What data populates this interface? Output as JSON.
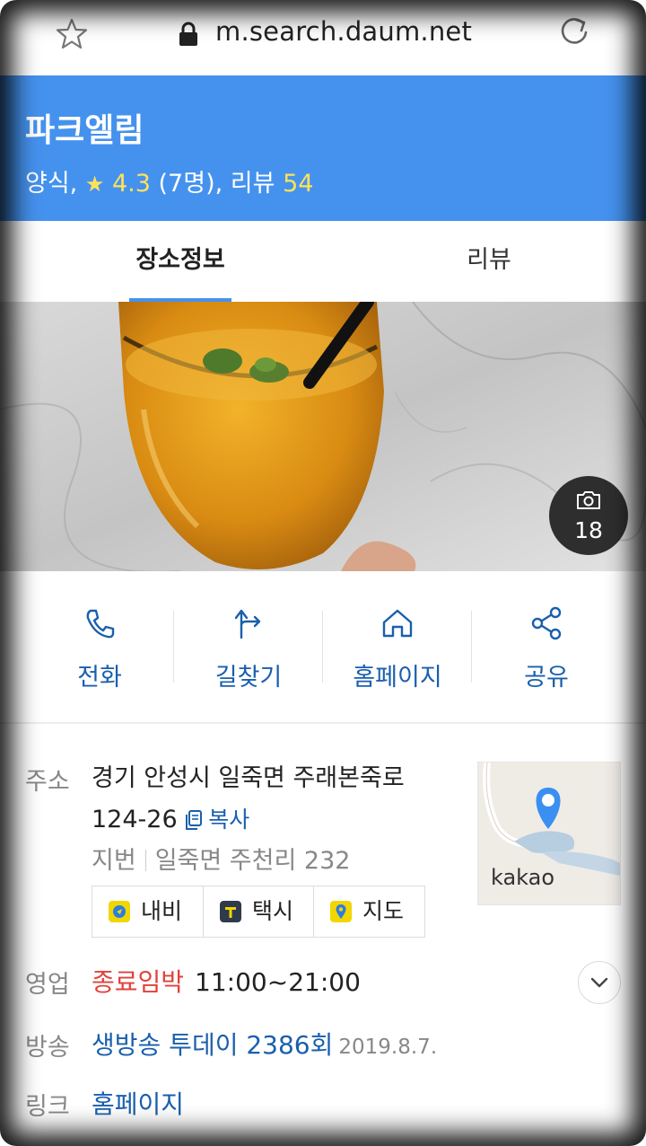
{
  "browser": {
    "url": "m.search.daum.net"
  },
  "header": {
    "name": "파크엘림",
    "category": "양식,",
    "rating": "4.3",
    "rating_count": "(7명),",
    "review_label": "리뷰",
    "review_count": "54"
  },
  "tabs": [
    {
      "label": "장소정보",
      "active": true
    },
    {
      "label": "리뷰",
      "active": false
    }
  ],
  "photo": {
    "count": "18"
  },
  "actions": [
    {
      "label": "전화",
      "icon": "phone-icon"
    },
    {
      "label": "길찾기",
      "icon": "directions-icon"
    },
    {
      "label": "홈페이지",
      "icon": "home-icon"
    },
    {
      "label": "공유",
      "icon": "share-icon"
    }
  ],
  "address": {
    "label": "주소",
    "line1": "경기 안성시 일죽면 주래본죽로",
    "line2": "124-26",
    "copy": "복사",
    "jibun_label": "지번",
    "jibun": "일죽면 주천리 232",
    "map_brand": "kakao"
  },
  "nav_buttons": [
    {
      "label": "내비",
      "color": "#f2d600"
    },
    {
      "label": "택시",
      "color": "#2f3b4c"
    },
    {
      "label": "지도",
      "color": "#f2d600"
    }
  ],
  "hours": {
    "label": "영업",
    "status": "종료임박",
    "time": "11:00~21:00"
  },
  "broadcast": {
    "label": "방송",
    "program": "생방송 투데이 2386회",
    "date": "2019.8.7."
  },
  "link": {
    "label": "링크",
    "text": "홈페이지"
  },
  "colors": {
    "header_blue": "#4592ee",
    "link_blue": "#1a5fad",
    "rating_yellow": "#ffe25a",
    "status_red": "#e0423a"
  }
}
